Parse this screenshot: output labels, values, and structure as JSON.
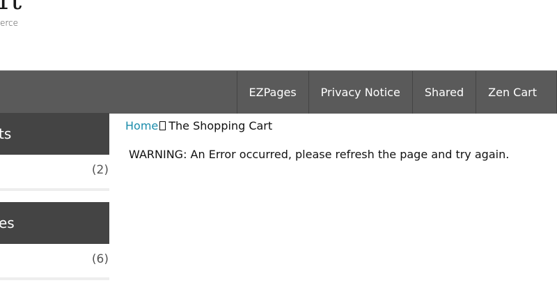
{
  "logo": {
    "text": "rt",
    "subtext": "erce"
  },
  "nav": {
    "items": [
      {
        "label": "EZPages"
      },
      {
        "label": "Privacy Notice"
      },
      {
        "label": "Shared"
      },
      {
        "label": "Zen Cart"
      }
    ]
  },
  "sidebar": {
    "boxes": [
      {
        "title": "ts",
        "count": "(2)"
      },
      {
        "title": "es",
        "count": "(6)"
      }
    ]
  },
  "breadcrumb": {
    "home": "Home",
    "current": "The Shopping Cart"
  },
  "main": {
    "warning": "WARNING: An Error occurred, please refresh the page and try again."
  },
  "colors": {
    "navbar": "#5a5a5a",
    "sidebar_header": "#444444",
    "link": "#1a8cab"
  }
}
